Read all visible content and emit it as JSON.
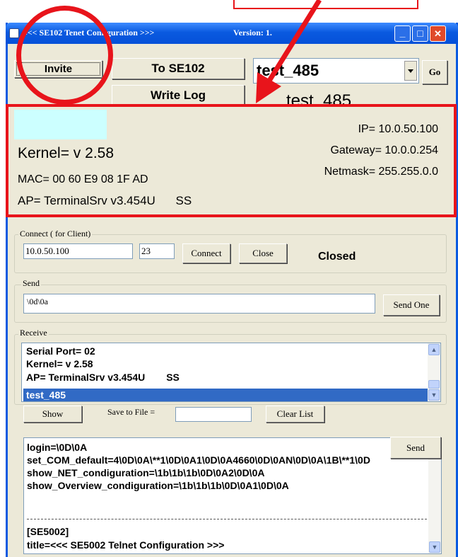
{
  "window": {
    "title_prefix": "<<< SE102 Te",
    "title_suffix": "net Configuration >>>",
    "version": "Version: 1.",
    "min_label": "_",
    "max_label": "□",
    "close_label": "✕"
  },
  "toolbar": {
    "invite_label": "Invite",
    "to_label": "To SE102",
    "write_log_label": "Write Log",
    "device_select_value": "test_485",
    "go_label": "Go",
    "device_name": "test_485"
  },
  "info": {
    "kernel": "Kernel= v 2.58",
    "mac": "MAC= 00 60 E9 08 1F AD",
    "ap": "AP= TerminalSrv v3.454U",
    "ap_flag": "SS",
    "ip": "IP= 10.0.50.100",
    "gateway": "Gateway= 10.0.0.254",
    "netmask": "Netmask= 255.255.0.0"
  },
  "connect": {
    "legend": "Connect ( for Client)",
    "ip_value": "10.0.50.100",
    "port_value": "23",
    "connect_label": "Connect",
    "close_label": "Close",
    "status": "Closed"
  },
  "send": {
    "legend": "Send",
    "value": "\\0d\\0a",
    "send_one_label": "Send One"
  },
  "receive": {
    "legend": "Receive",
    "items": [
      {
        "text": "Serial Port= 02"
      },
      {
        "text": "Kernel= v 2.58"
      },
      {
        "text": "AP= TerminalSrv v3.454U",
        "flag": "SS"
      },
      {
        "text": "test_485"
      }
    ],
    "selected_index": 3,
    "show_label": "Show",
    "save_label": "Save to File =",
    "save_value": "",
    "clear_label": "Clear List"
  },
  "commands": {
    "lines": [
      "login=\\0D\\0A",
      "set_COM_default=4\\0D\\0A\\**1\\0D\\0A1\\0D\\0A4660\\0D\\0AN\\0D\\0A\\1B\\**1\\0D",
      "show_NET_condiguration=\\1b\\1b\\1b\\0D\\0A2\\0D\\0A",
      "show_Overview_condiguration=\\1b\\1b\\1b\\0D\\0A1\\0D\\0A",
      "",
      "[SE5002]",
      "title=<<< SE5002 Telnet Configuration >>>"
    ],
    "send_label": "Send"
  },
  "colors": {
    "annotation": "#e8141b",
    "xp_blue": "#0a5ae0",
    "selection": "#316ac5",
    "panel": "#ece9d8",
    "status_swatch": "#ccffff"
  }
}
